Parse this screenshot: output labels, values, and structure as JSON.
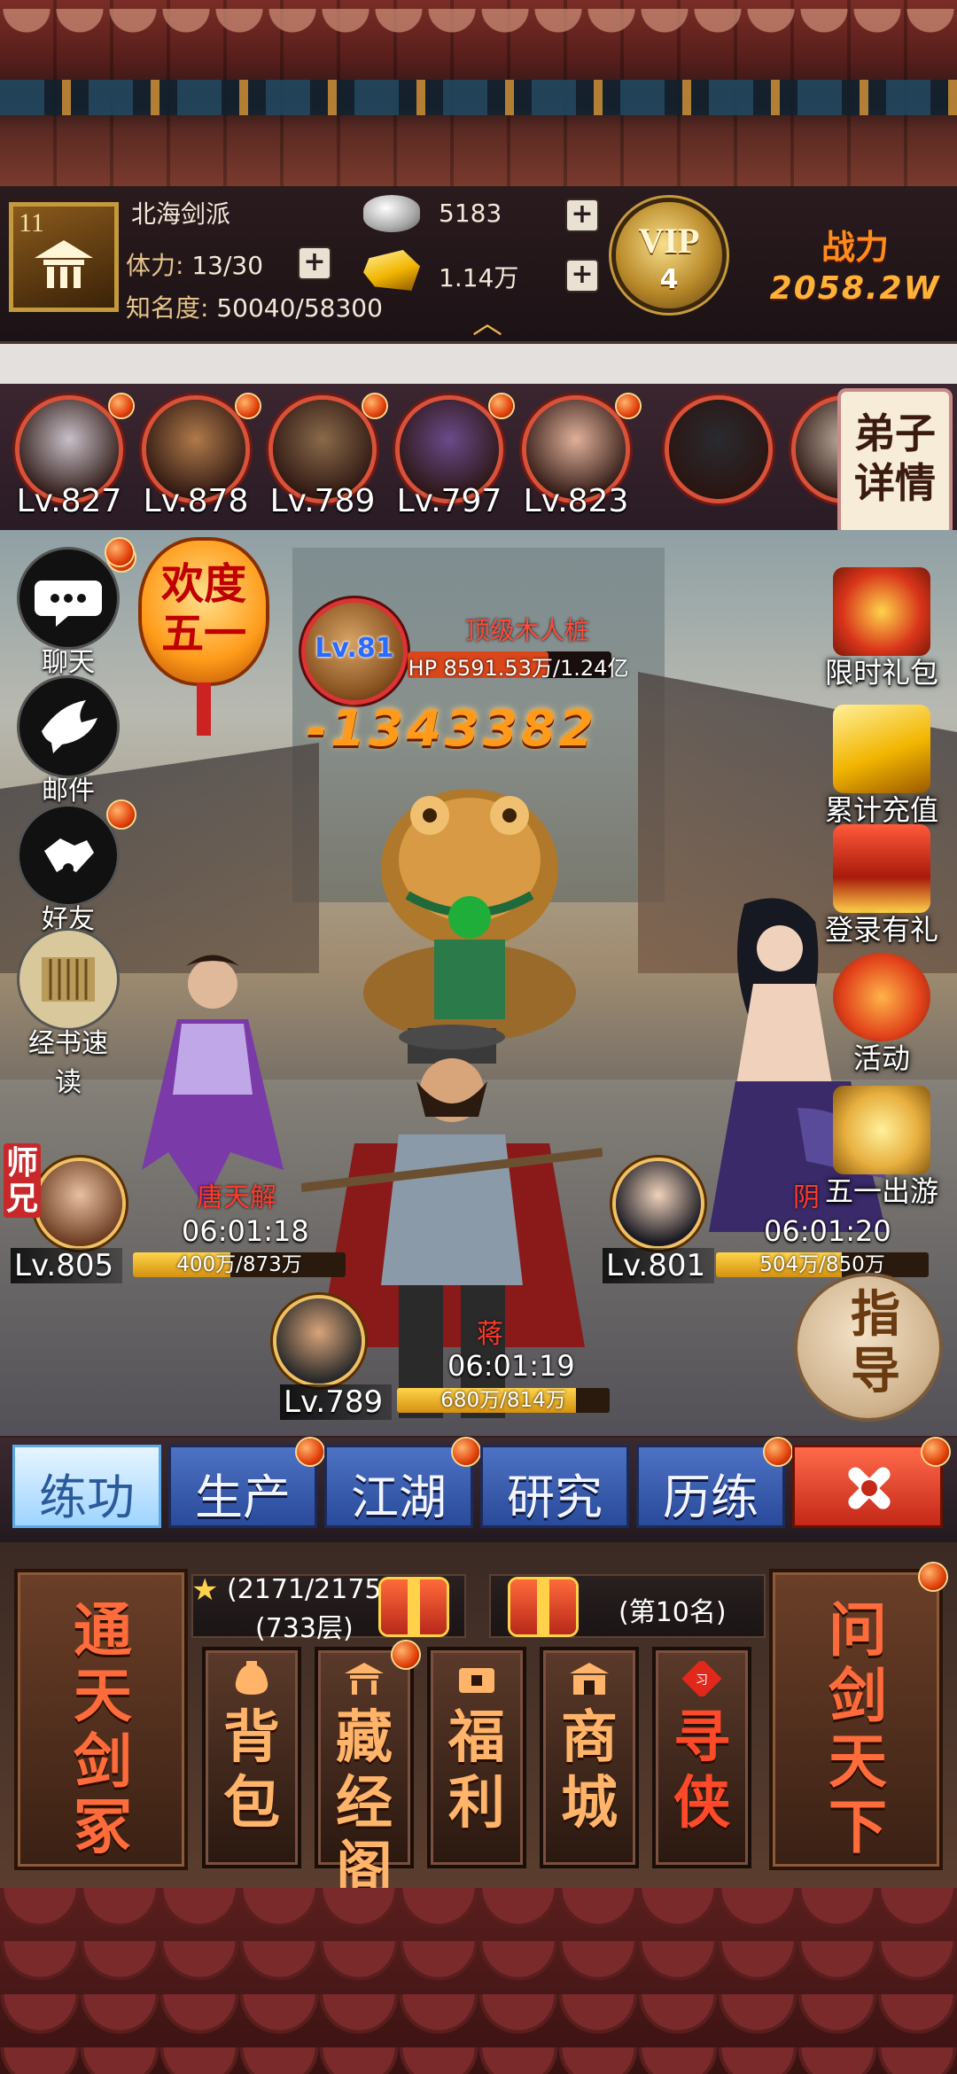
{
  "header": {
    "sect_name": "北海剑派",
    "stamina_label": "体力:",
    "stamina_value": "13/30",
    "fame_label": "知名度:",
    "fame_value": "50040/58300",
    "player_level": "11",
    "silver": "5183",
    "gold": "1.14万",
    "vip_text": "VIP",
    "vip_level": "4",
    "power_label": "战力",
    "power_value": "2058.2W"
  },
  "disciples": [
    {
      "level": "Lv.827"
    },
    {
      "level": "Lv.878"
    },
    {
      "level": "Lv.789"
    },
    {
      "level": "Lv.797"
    },
    {
      "level": "Lv.823"
    },
    {
      "level": ""
    },
    {
      "level": ""
    }
  ],
  "detail_button": "弟子详情",
  "left_menu": [
    "聊天",
    "邮件",
    "好友",
    "经书速读"
  ],
  "event_banner": "欢度五一",
  "right_menu": [
    "限时礼包",
    "累计充值",
    "登录有礼",
    "活动",
    "五一出游"
  ],
  "boss": {
    "level": "Lv.81",
    "name": "顶级木人桩",
    "hp_text": "HP 8591.53万/1.24亿",
    "hp_fraction": 0.69,
    "damage": "-1343382"
  },
  "heroes": [
    {
      "name": "唐天解",
      "time": "06:01:18",
      "level": "Lv.805",
      "hp_text": "400万/873万",
      "hp_fraction": 0.46,
      "tag": "师兄"
    },
    {
      "name": "阴",
      "time": "06:01:20",
      "level": "Lv.801",
      "hp_text": "504万/850万",
      "hp_fraction": 0.59
    },
    {
      "name": "蒋",
      "time": "06:01:19",
      "level": "Lv.789",
      "hp_text": "680万/814万",
      "hp_fraction": 0.84
    }
  ],
  "guide_button": "指导",
  "tabs": [
    "练功",
    "生产",
    "江湖",
    "研究",
    "历练",
    ""
  ],
  "tower": {
    "stars": "(2171/2175)",
    "floor": "(733层)"
  },
  "rank": "(第10名)",
  "big_left": "通天剑冢",
  "big_right": "问剑天下",
  "cards": [
    "背包",
    "藏经阁",
    "福利",
    "商城",
    "寻侠"
  ],
  "colors": {
    "accent_gold": "#c59a3c",
    "power_orange": "#ff8c1a",
    "tab_blue": "#2a4a9a",
    "notify_red": "#e2420c"
  }
}
